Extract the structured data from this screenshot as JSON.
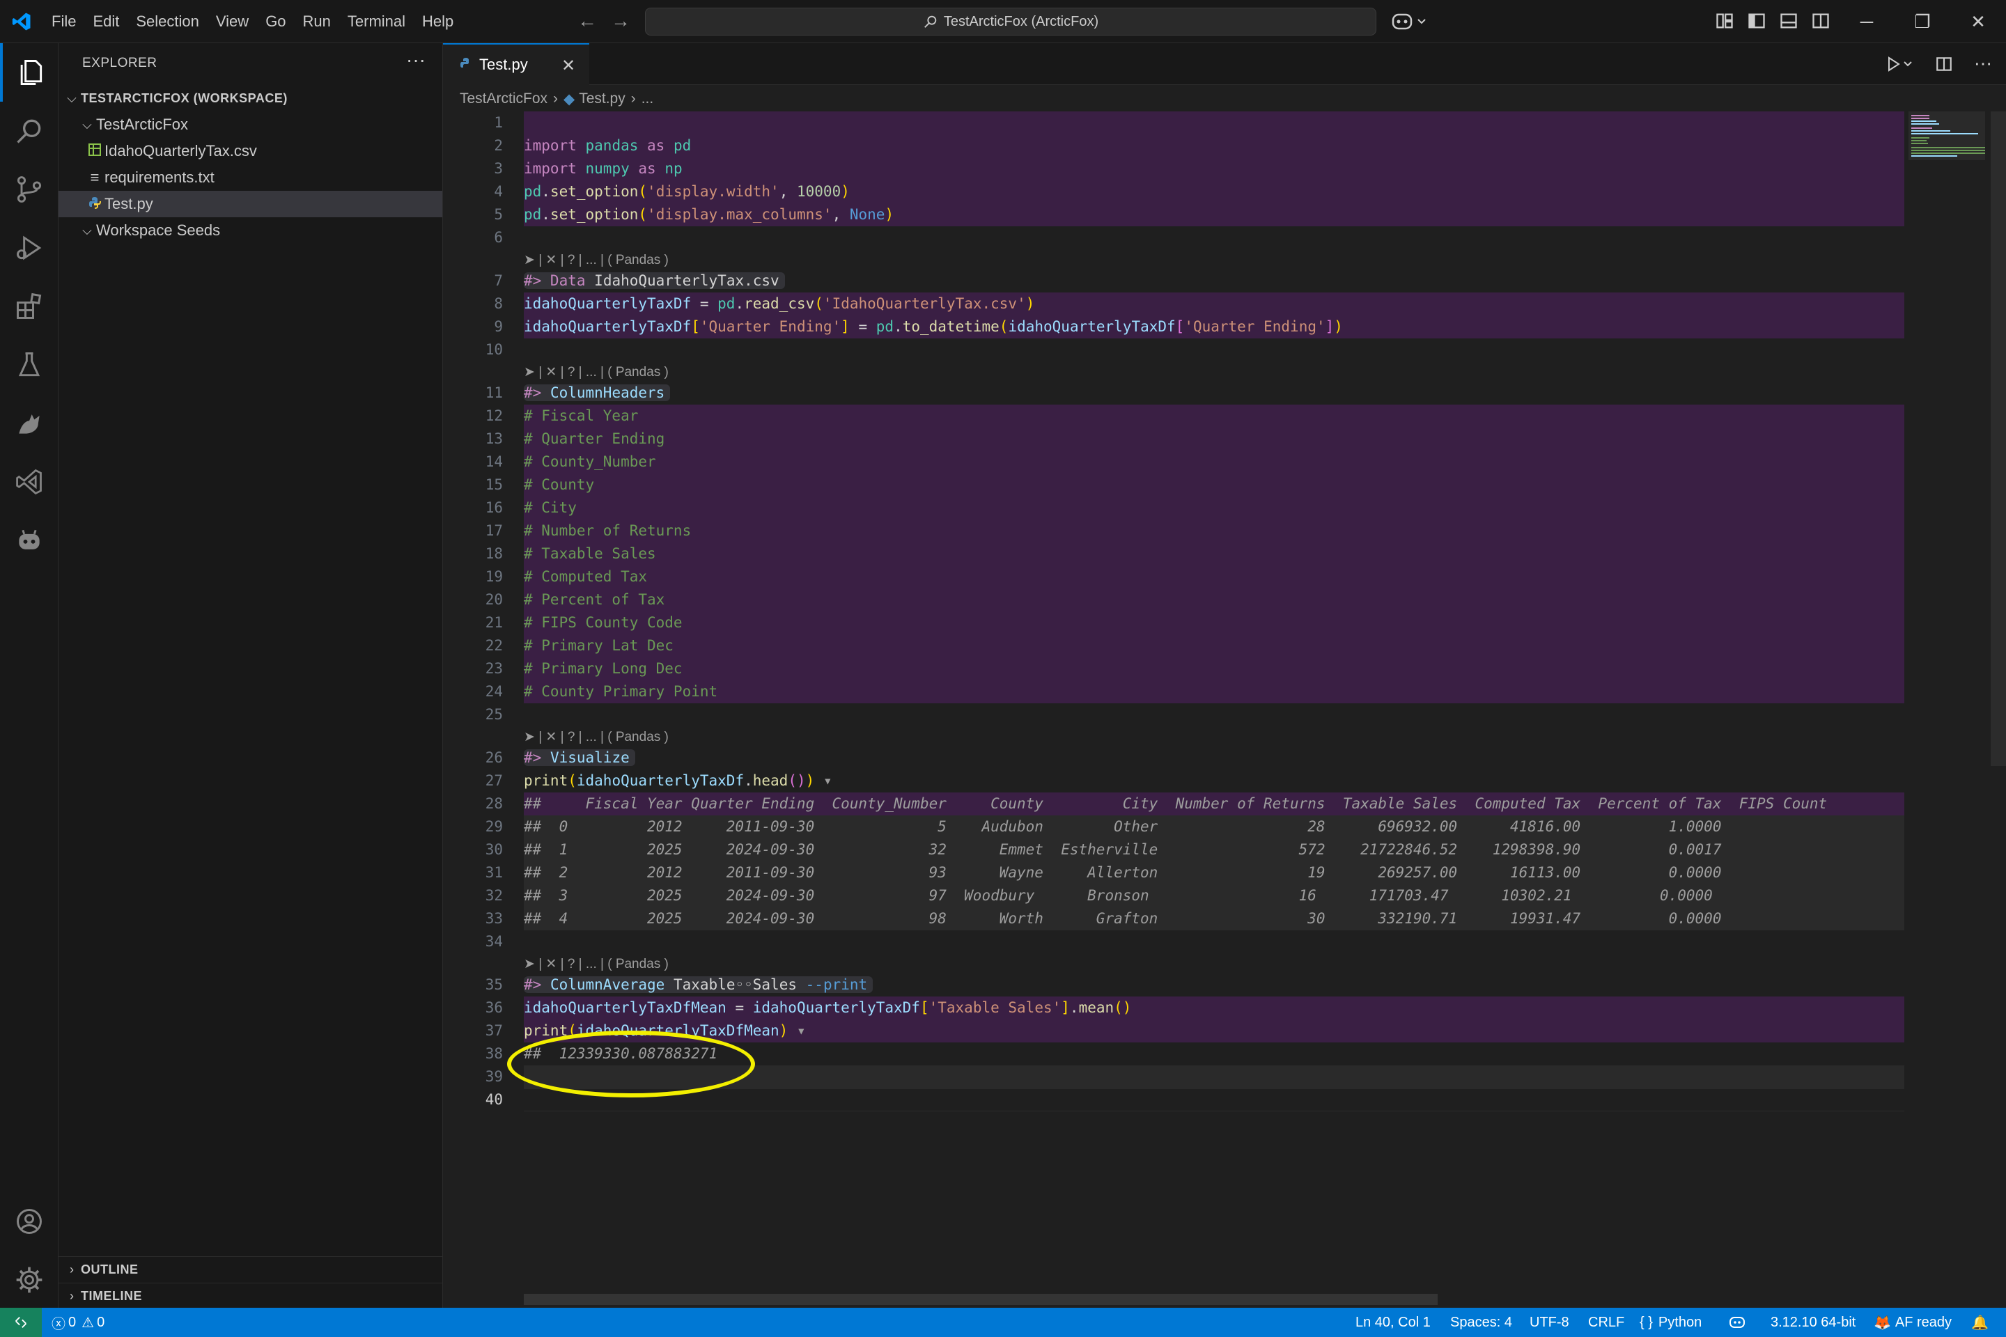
{
  "window": {
    "title": "TestArcticFox (ArcticFox)"
  },
  "menu": [
    "File",
    "Edit",
    "Selection",
    "View",
    "Go",
    "Run",
    "Terminal",
    "Help"
  ],
  "sidebar": {
    "title": "EXPLORER",
    "more": "···",
    "workspace": "TESTARCTICFOX (WORKSPACE)",
    "folder": "TestArcticFox",
    "files": [
      "IdahoQuarterlyTax.csv",
      "requirements.txt",
      "Test.py"
    ],
    "seeds": "Workspace Seeds",
    "outline": "OUTLINE",
    "timeline": "TIMELINE"
  },
  "tabs": [
    {
      "label": "Test.py",
      "close": "✕"
    }
  ],
  "breadcrumbs": [
    "TestArcticFox",
    "Test.py",
    "..."
  ],
  "editor": {
    "line_numbers": [
      "1",
      "2",
      "3",
      "4",
      "5",
      "6",
      "7",
      "8",
      "9",
      "10",
      "11",
      "12",
      "13",
      "14",
      "15",
      "16",
      "17",
      "18",
      "19",
      "20",
      "21",
      "22",
      "23",
      "24",
      "25",
      "26",
      "27",
      "28",
      "29",
      "30",
      "31",
      "32",
      "33",
      "34",
      "35",
      "36",
      "37",
      "38",
      "39",
      "40"
    ],
    "codelens": "➤ | ✕ | ? | ... | ( Pandas )",
    "line_text": {
      "l2": "import pandas as pd",
      "l3": "import numpy as np",
      "l4": "pd.set_option('display.width', 10000)",
      "l5": "pd.set_option('display.max_columns', None)",
      "l7": "#> Data IdahoQuarterlyTax.csv",
      "l8": "idahoQuarterlyTaxDf = pd.read_csv('IdahoQuarterlyTax.csv')",
      "l9": "idahoQuarterlyTaxDf['Quarter Ending'] = pd.to_datetime(idahoQuarterlyTaxDf['Quarter Ending'])",
      "l11": "#> ColumnHeaders",
      "l12": "# Fiscal Year",
      "l13": "# Quarter Ending",
      "l14": "# County_Number",
      "l15": "# County",
      "l16": "# City",
      "l17": "# Number of Returns",
      "l18": "# Taxable Sales",
      "l19": "# Computed Tax",
      "l20": "# Percent of Tax",
      "l21": "# FIPS County Code",
      "l22": "# Primary Lat Dec",
      "l23": "# Primary Long Dec",
      "l24": "# County Primary Point",
      "l26": "#> Visualize",
      "l27": "print(idahoQuarterlyTaxDf.head())",
      "l28": "##     Fiscal Year Quarter Ending  County_Number     County         City  Number of Returns  Taxable Sales  Computed Tax  Percent of Tax  FIPS Count",
      "l29": "##  0         2012     2011-09-30              5    Audubon        Other                 28      696932.00      41816.00          1.0000",
      "l30": "##  1         2025     2024-09-30             32      Emmet  Estherville                572    21722846.52    1298398.90          0.0017",
      "l31": "##  2         2012     2011-09-30             93      Wayne     Allerton                 19      269257.00      16113.00          0.0000",
      "l32": "##  3         2025     2024-09-30             97  Woodbury      Bronson                 16      171703.47      10302.21          0.0000",
      "l33": "##  4         2025     2024-09-30             98      Worth      Grafton                 30      332190.71      19931.47          0.0000",
      "l35": "#> ColumnAverage Taxable◦◦Sales --print",
      "l36": "idahoQuarterlyTaxDfMean = idahoQuarterlyTaxDf['Taxable Sales'].mean()",
      "l37": "print(idahoQuarterlyTaxDfMean)",
      "l38": "##  12339330.087883271"
    }
  },
  "statusbar": {
    "errors": "0",
    "warnings": "0",
    "position": "Ln 40, Col 1",
    "spaces": "Spaces: 4",
    "encoding": "UTF-8",
    "eol": "CRLF",
    "language": "Python",
    "interpreter": "3.12.10 64-bit",
    "af": "AF ready"
  },
  "colors": {
    "accent": "#0078d4",
    "cell_highlight": "#3a1f44",
    "annotation": "#f3ef00"
  }
}
